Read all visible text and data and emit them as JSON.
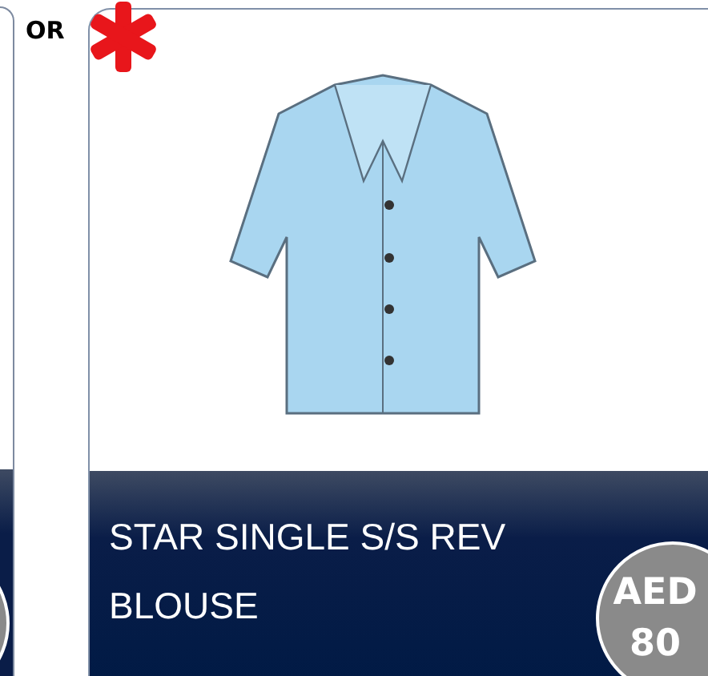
{
  "separator": "OR",
  "product": {
    "name": "STAR SINGLE S/S REV BLOUSE",
    "currency": "AED",
    "amount": "80",
    "required": true
  }
}
